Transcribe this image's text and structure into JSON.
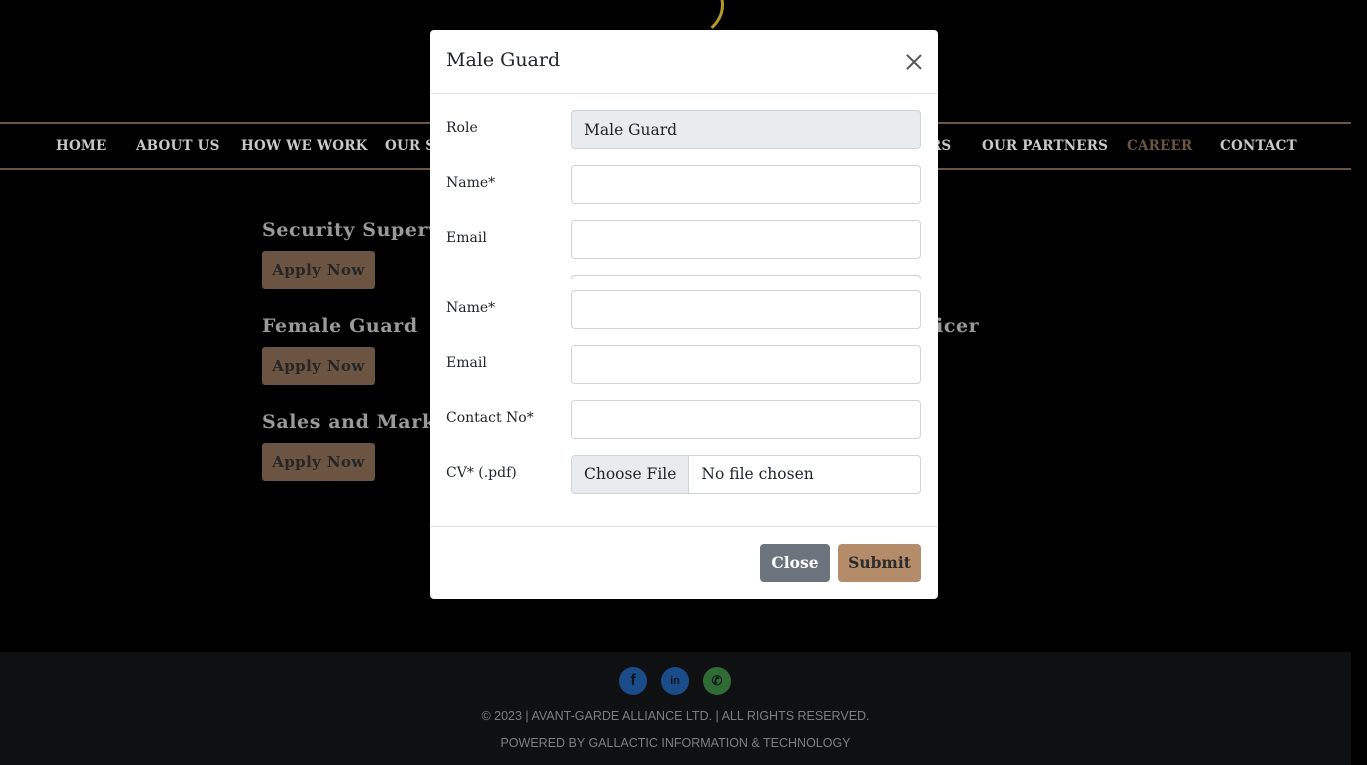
{
  "nav": {
    "items": [
      "HOME",
      "ABOUT US",
      "HOW WE WORK",
      "OUR S",
      "RS",
      "OUR PARTNERS",
      "CAREER",
      "CONTACT"
    ],
    "active": "CAREER"
  },
  "jobs": {
    "col1": [
      "Security Superv",
      "Female Guard",
      "Sales and Mark"
    ],
    "col2_partial": "icer",
    "apply_label": "Apply Now"
  },
  "footer": {
    "copyright": "© 2023 | AVANT-GARDE ALLIANCE LTD. | ALL RIGHTS RESERVED.",
    "powered": "POWERED BY GALLACTIC INFORMATION & TECHNOLOGY",
    "social_icons": [
      "facebook-icon",
      "linkedin-icon",
      "whatsapp-icon"
    ]
  },
  "modal": {
    "title": "Male Guard",
    "fields": {
      "role_label": "Role",
      "role_value": "Male Guard",
      "name_label": "Name*",
      "email_label": "Email",
      "name2_label": "Name*",
      "email2_label": "Email",
      "contact_label": "Contact No*",
      "cv_label": "CV* (.pdf)",
      "choose_file": "Choose File",
      "no_file": "No file chosen"
    },
    "close_label": "Close",
    "submit_label": "Submit"
  },
  "colors": {
    "brand_brown": "#6b5441",
    "submit_bg": "#b48c69",
    "close_bg": "#6c757d"
  }
}
